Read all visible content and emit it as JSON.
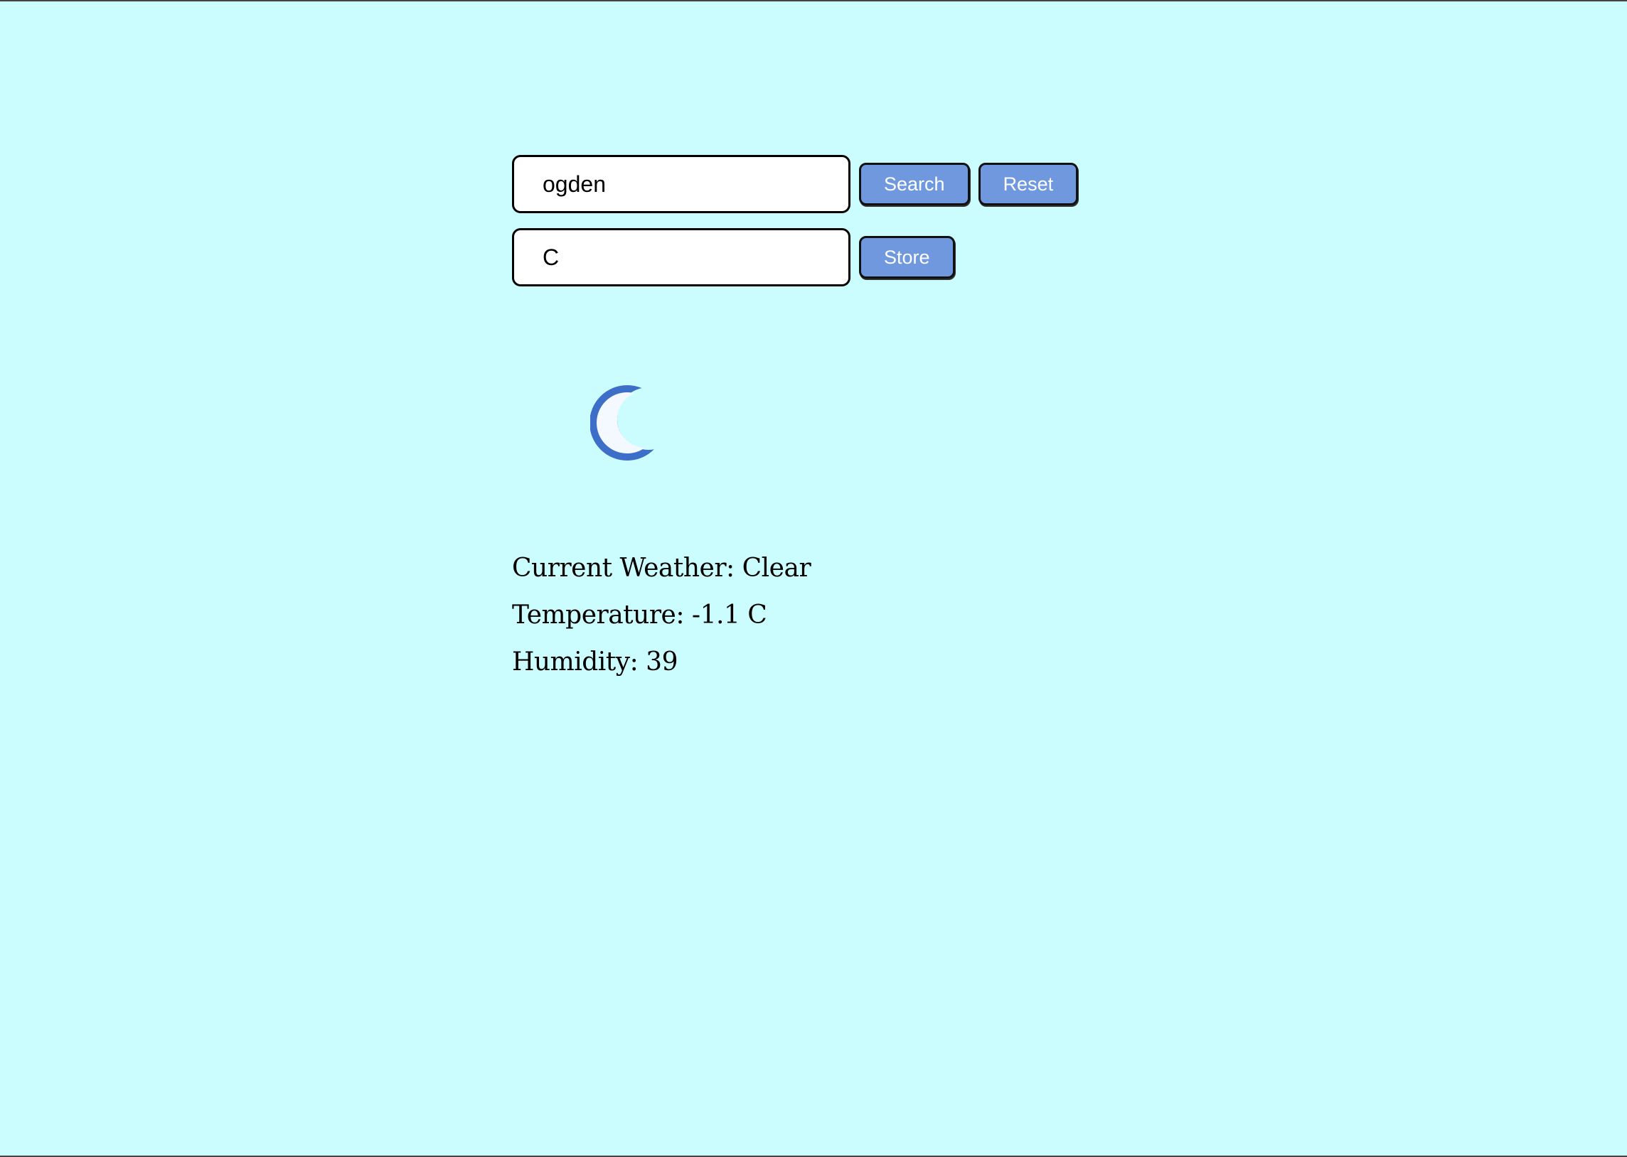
{
  "search": {
    "city_value": "ogden",
    "search_label": "Search",
    "reset_label": "Reset"
  },
  "units": {
    "unit_value": "C",
    "store_label": "Store"
  },
  "weather": {
    "icon": "moon-icon",
    "current_weather": "Current Weather: Clear",
    "temperature": "Temperature: -1.1 C",
    "humidity": "Humidity: 39"
  },
  "colors": {
    "background": "#ccfdfe",
    "button": "#6f98de",
    "moon": "#3d6fc8"
  }
}
